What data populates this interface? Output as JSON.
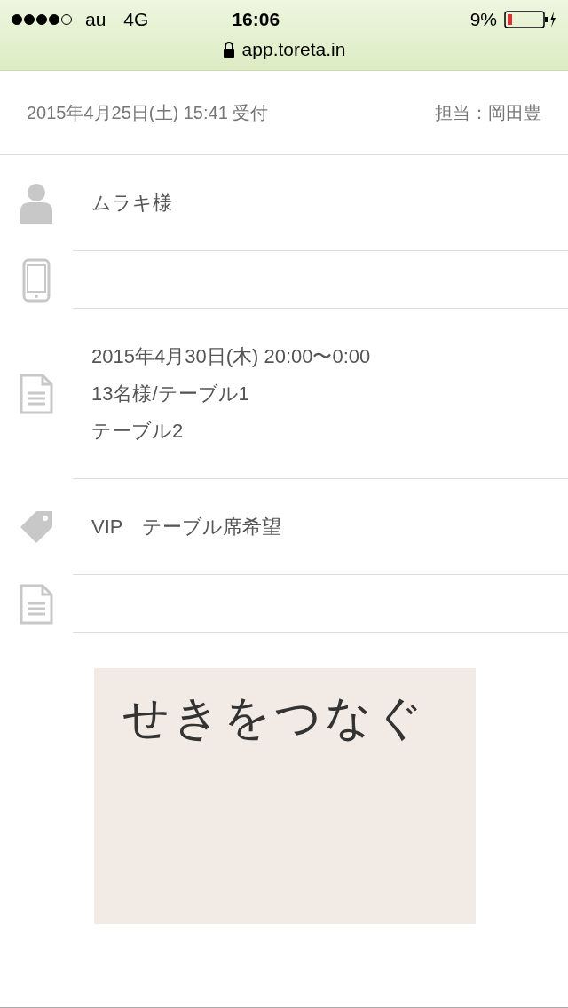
{
  "status_bar": {
    "carrier": "au",
    "network": "4G",
    "time": "16:06",
    "battery": "9%",
    "url": "app.toreta.in"
  },
  "header": {
    "received": "2015年4月25日(土) 15:41 受付",
    "staff": "担当：岡田豊"
  },
  "rows": [
    {
      "kind": "person",
      "lines": [
        "ムラキ様"
      ]
    },
    {
      "kind": "phone",
      "lines": []
    },
    {
      "kind": "document",
      "lines": [
        "2015年4月30日(木) 20:00〜0:00",
        "13名様/テーブル1",
        "テーブル2"
      ]
    },
    {
      "kind": "tag",
      "lines": [
        "VIP　テーブル席希望"
      ]
    },
    {
      "kind": "document",
      "lines": []
    }
  ],
  "memo": {
    "text": "せきをつなぐ"
  }
}
